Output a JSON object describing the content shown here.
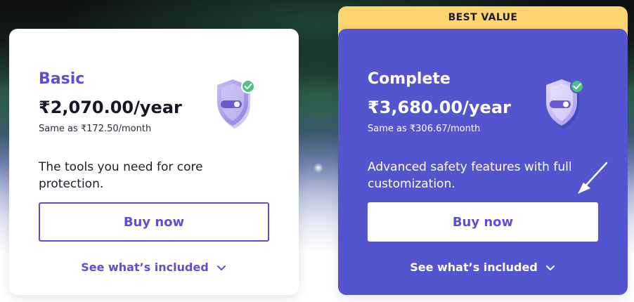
{
  "colors": {
    "accent": "#5c4fd6",
    "complete_card_bg": "#5454cf",
    "best_value_badge": "#ffd571",
    "shield_check": "#4fbf86"
  },
  "plans": [
    {
      "name": "Basic",
      "price": "₹2,070.00/year",
      "per_month": "Same as ₹172.50/month",
      "description": "The tools you need for core protection.",
      "buy_label": "Buy now",
      "see_included_label": "See what’s included",
      "icon": "shield-check-icon"
    },
    {
      "name": "Complete",
      "badge": "BEST VALUE",
      "price": "₹3,680.00/year",
      "per_month": "Same as ₹306.67/month",
      "description": "Advanced safety features with full customization.",
      "buy_label": "Buy now",
      "see_included_label": "See what’s included",
      "icon": "shield-check-icon"
    }
  ],
  "annotation": {
    "icon": "arrow-pointer-icon"
  }
}
